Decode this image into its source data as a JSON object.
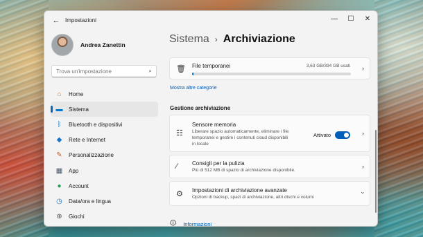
{
  "window": {
    "app_title": "Impostazioni",
    "controls": {
      "minimize": "—",
      "maximize": "☐",
      "close": "✕"
    }
  },
  "profile": {
    "name": "Andrea Zanettin"
  },
  "search": {
    "placeholder": "Trova un'impostazione",
    "icon": "search-icon"
  },
  "sidebar": {
    "items": [
      {
        "label": "Home",
        "icon": "home-icon",
        "glyph": "⌂",
        "color": "#d47a2a"
      },
      {
        "label": "Sistema",
        "icon": "monitor-icon",
        "glyph": "▬",
        "color": "#0078d4",
        "active": true
      },
      {
        "label": "Bluetooth e dispositivi",
        "icon": "bluetooth-icon",
        "glyph": "ᛒ",
        "color": "#0078d4"
      },
      {
        "label": "Rete e Internet",
        "icon": "wifi-icon",
        "glyph": "◆",
        "color": "#1a73c7"
      },
      {
        "label": "Personalizzazione",
        "icon": "brush-icon",
        "glyph": "✎",
        "color": "#c05a2a"
      },
      {
        "label": "App",
        "icon": "apps-icon",
        "glyph": "▦",
        "color": "#4a5a6a"
      },
      {
        "label": "Account",
        "icon": "account-icon",
        "glyph": "●",
        "color": "#2e9a5a"
      },
      {
        "label": "Data/ora e lingua",
        "icon": "globe-clock-icon",
        "glyph": "◷",
        "color": "#1a73c7"
      },
      {
        "label": "Giochi",
        "icon": "gamepad-icon",
        "glyph": "⊕",
        "color": "#555555"
      }
    ]
  },
  "header": {
    "crumb": "Sistema",
    "separator": "›",
    "title": "Archiviazione"
  },
  "temp_files": {
    "title": "File temporanei",
    "usage": "3,63 GB/394 GB usati",
    "usage_fraction": 0.0092
  },
  "more_link": "Mostra altre categorie",
  "section_title": "Gestione archiviazione",
  "cards": {
    "sensor": {
      "title": "Sensore memoria",
      "desc_line1": "Liberare spazio automaticamente, eliminare i file",
      "desc_line2": "temporanei e gestire i contenuti cloud disponibili",
      "desc_line3": "in locale",
      "toggle_label": "Attivato",
      "toggle_on": true
    },
    "cleanup": {
      "title": "Consigli per la pulizia",
      "desc": "Più di 512 MB di spazio di archiviazione disponibile."
    },
    "advanced": {
      "title": "Impostazioni di archiviazione avanzate",
      "desc": "Opzioni di backup, spazi di archiviazione, altri dischi e volumi"
    }
  },
  "footer": {
    "info_label": "Informazioni"
  },
  "colors": {
    "accent": "#005fb8",
    "window_bg": "#f3f3f3"
  }
}
